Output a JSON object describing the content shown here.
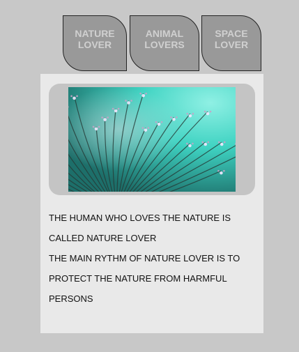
{
  "tabs": [
    {
      "label": "NATURE\nLOVER"
    },
    {
      "label": "ANIMAL\nLOVERS"
    },
    {
      "label": "SPACE\nLOVER"
    }
  ],
  "colors": {
    "page_bg": "#c8c8c8",
    "tab_bg": "#999999",
    "tab_text": "#d0d0d0",
    "panel_bg": "#e9e9e9",
    "image_frame": "#c4c4c4"
  },
  "content": {
    "image_icon": "dandelion-photo",
    "paragraph1": "THE HUMAN WHO LOVES THE NATURE IS CALLED NATURE LOVER",
    "paragraph2": "THE MAIN RYTHM OF NATURE LOVER IS TO PROTECT THE NATURE FROM HARMFUL PERSONS"
  }
}
